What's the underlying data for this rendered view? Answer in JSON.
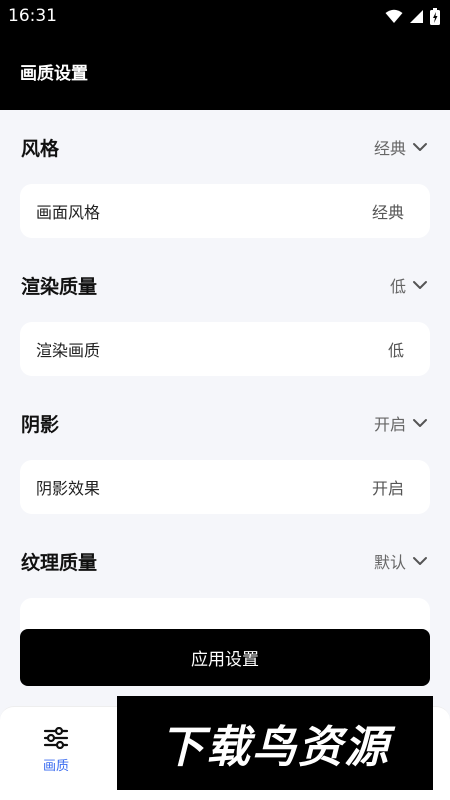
{
  "status_bar": {
    "time": "16:31"
  },
  "header": {
    "title": "画质设置"
  },
  "sections": [
    {
      "title": "风格",
      "value": "经典",
      "item_label": "画面风格",
      "item_value": "经典"
    },
    {
      "title": "渲染质量",
      "value": "低",
      "item_label": "渲染画质",
      "item_value": "低"
    },
    {
      "title": "阴影",
      "value": "开启",
      "item_label": "阴影效果",
      "item_value": "开启"
    },
    {
      "title": "纹理质量",
      "value": "默认",
      "item_label": "",
      "item_value": ""
    }
  ],
  "apply_button": {
    "label": "应用设置"
  },
  "bottom_nav": {
    "items": [
      {
        "label": "画质",
        "icon": "sliders-icon",
        "active": true
      }
    ],
    "active_color": "#3b6cf0"
  },
  "watermark": {
    "text": "下载鸟资源"
  }
}
